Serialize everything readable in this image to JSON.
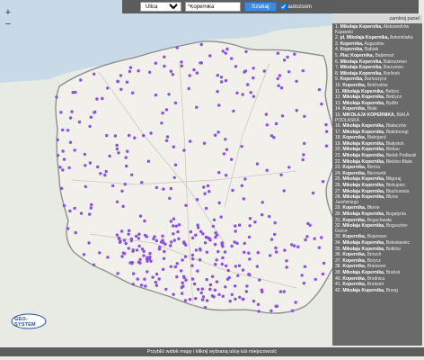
{
  "toolbar": {
    "street_type_selected": "Ulica",
    "search_value": "*Kopernika",
    "search_button": "Szukaj",
    "autozoom_label": "autozoom",
    "autozoom_checked": true
  },
  "zoom": {
    "in_label": "+",
    "out_label": "−"
  },
  "panel": {
    "title": "zamknij panel",
    "results": [
      {
        "n": "1.",
        "name": "Mikołaja Kopernika,",
        "loc": "Aleksandrów Kujawski"
      },
      {
        "n": "2.",
        "name": "pl. Mikołaja Kopernika,",
        "loc": "Antoniówka"
      },
      {
        "n": "3.",
        "name": "Kopernika,",
        "loc": "Augustów"
      },
      {
        "n": "4.",
        "name": "Kopernika,",
        "loc": "Babiak"
      },
      {
        "n": "5.",
        "name": "Plac Kopernika,",
        "loc": "Babimost"
      },
      {
        "n": "6.",
        "name": "Mikołaja Kopernika,",
        "loc": "Baboszewo"
      },
      {
        "n": "7.",
        "name": "Mikołaja Kopernika,",
        "loc": "Barczewo"
      },
      {
        "n": "8.",
        "name": "Mikołaja Kopernika,",
        "loc": "Barlinek"
      },
      {
        "n": "9.",
        "name": "Kopernika,",
        "loc": "Bartoszyce"
      },
      {
        "n": "10.",
        "name": "Kopernika,",
        "loc": "Bełchatów"
      },
      {
        "n": "11.",
        "name": "Mikołaja Kopernika,",
        "loc": "Bełżec"
      },
      {
        "n": "12.",
        "name": "Mikołaja Kopernika,",
        "loc": "Bełżyce"
      },
      {
        "n": "13.",
        "name": "Mikołaja Kopernika,",
        "loc": "Bydlin"
      },
      {
        "n": "14.",
        "name": "Kopernika,",
        "loc": "Biała"
      },
      {
        "n": "15.",
        "name": "MIKOŁAJA KOPERNIKA,",
        "loc": "BIAŁA PODLASKA"
      },
      {
        "n": "16.",
        "name": "Mikołaja Kopernika,",
        "loc": "Białaczów"
      },
      {
        "n": "17.",
        "name": "Mikołaja Kopernika,",
        "loc": "Białobrzegi"
      },
      {
        "n": "18.",
        "name": "Kopernika,",
        "loc": "Białogard"
      },
      {
        "n": "19.",
        "name": "Mikołaja Kopernika,",
        "loc": "Białystok"
      },
      {
        "n": "20.",
        "name": "Mikołaja Kopernika,",
        "loc": "Biskau"
      },
      {
        "n": "21.",
        "name": "Mikołaja Kopernika,",
        "loc": "Bielsk Podlaski"
      },
      {
        "n": "22.",
        "name": "Mikołaja Kopernika,",
        "loc": "Bielsko-Biała"
      },
      {
        "n": "23.",
        "name": "Kopernika,",
        "loc": "Bierna"
      },
      {
        "n": "24.",
        "name": "Kopernika,",
        "loc": "Bierzwnik"
      },
      {
        "n": "25.",
        "name": "Mikołaja Kopernika,",
        "loc": "Biłgoraj"
      },
      {
        "n": "26.",
        "name": "Mikołaja Kopernika,",
        "loc": "Biskupiec"
      },
      {
        "n": "27.",
        "name": "Mikołaja Kopernika,",
        "loc": "Blachownia"
      },
      {
        "n": "28.",
        "name": "Mikołaja Kopernika,",
        "loc": "Bliżne Jasińskiego"
      },
      {
        "n": "29.",
        "name": "Kopernika,",
        "loc": "Błonie"
      },
      {
        "n": "30.",
        "name": "Mikołaja Kopernika,",
        "loc": "Bogatynia"
      },
      {
        "n": "31.",
        "name": "Kopernika,",
        "loc": "Boguchwała"
      },
      {
        "n": "32.",
        "name": "Mikołaja Kopernika,",
        "loc": "Boguszów-Gorce"
      },
      {
        "n": "33.",
        "name": "Kopernika,",
        "loc": "Bojanowo"
      },
      {
        "n": "34.",
        "name": "Mikołaja Kopernika,",
        "loc": "Bolesławiec"
      },
      {
        "n": "35.",
        "name": "Mikołaja Kopernika,",
        "loc": "Bolków"
      },
      {
        "n": "36.",
        "name": "Kopernika,",
        "loc": "Boruch"
      },
      {
        "n": "37.",
        "name": "Kopernika,",
        "loc": "Borycz"
      },
      {
        "n": "38.",
        "name": "Kopernika,",
        "loc": "Braniewo"
      },
      {
        "n": "39.",
        "name": "Mikołaja Kopernika,",
        "loc": "Brańsk"
      },
      {
        "n": "40.",
        "name": "Kopernika,",
        "loc": "Brodnica"
      },
      {
        "n": "41.",
        "name": "Kopernika,",
        "loc": "Brudzeń"
      },
      {
        "n": "42.",
        "name": "Mikołaja Kopernika,",
        "loc": "Brzeg"
      }
    ]
  },
  "footer": {
    "text": "Przybliż widok mapy i kliknij wybraną ulicę lub miejscowość"
  },
  "logo": {
    "text": "GEO-SYSTEM"
  },
  "colors": {
    "marker": "#8a4fe8",
    "border": "#8e8e8e",
    "panel_bg": "#6a6a6a",
    "button": "#3f8ae0"
  }
}
